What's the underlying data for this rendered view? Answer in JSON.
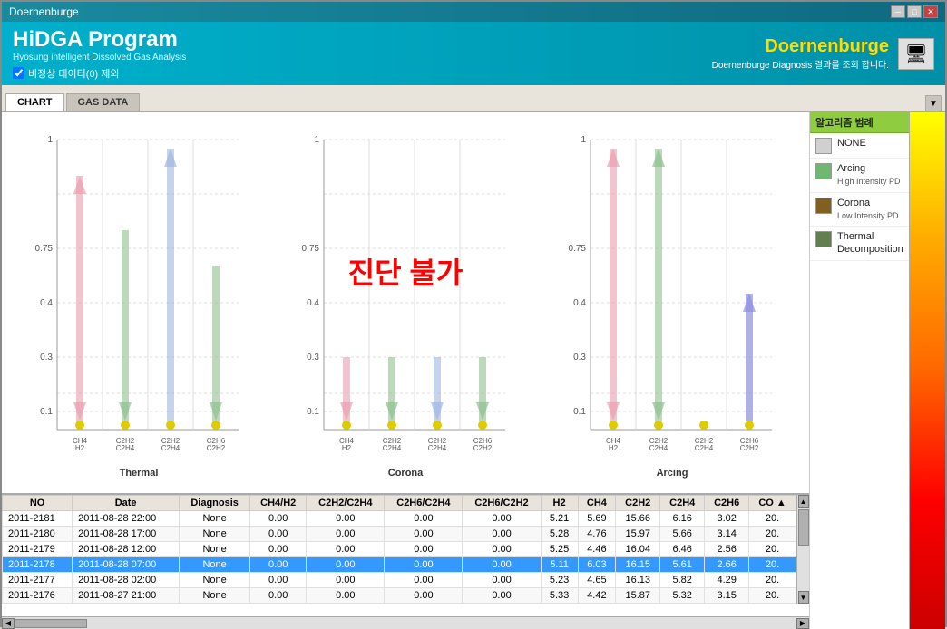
{
  "window": {
    "title": "Doernenburge"
  },
  "header": {
    "program_name": "HiDGA Program",
    "program_subtitle": "Hyosung intelligent Dissolved Gas Analysis",
    "checkbox_label": "비정상 데이터(0) 제외",
    "brand_name": "Doernenburge",
    "brand_subtitle": "Doernenburge Diagnosis 결과를 조회 합니다."
  },
  "tabs": [
    {
      "id": "chart",
      "label": "CHART",
      "active": true
    },
    {
      "id": "gas-data",
      "label": "GAS DATA",
      "active": false
    }
  ],
  "charts": [
    {
      "id": "thermal",
      "label": "Thermal",
      "x_labels": [
        "CH4\nH2",
        "C2H2\nC2H4",
        "C2H2\nC2H4",
        "C2H6\nC2H2"
      ],
      "overlay_text": ""
    },
    {
      "id": "corona",
      "label": "Corona",
      "x_labels": [
        "CH4\nH2",
        "C2H2\nC2H4",
        "C2H2\nC2H4",
        "C2H6\nC2H2"
      ],
      "overlay_text": "진단 불가"
    },
    {
      "id": "arcing",
      "label": "Arcing",
      "x_labels": [
        "CH4\nH2",
        "C2H2\nC2H4",
        "C2H2\nC2H4",
        "C2H6\nC2H2"
      ],
      "overlay_text": ""
    }
  ],
  "legend": {
    "header": "알고리즘 범례",
    "items": [
      {
        "id": "none",
        "color": "#d0d0d0",
        "label": "NONE",
        "sub": ""
      },
      {
        "id": "arcing",
        "color": "#70b870",
        "label": "Arcing",
        "sub": "High Intensity PD"
      },
      {
        "id": "corona",
        "color": "#806020",
        "label": "Corona",
        "sub": "Low Intensity PD"
      },
      {
        "id": "thermal",
        "color": "#608050",
        "label": "Thermal\nDecomposition",
        "sub": ""
      }
    ]
  },
  "table": {
    "columns": [
      "NO",
      "Date",
      "Diagnosis",
      "CH4/H2",
      "C2H2/C2H4",
      "C2H6/C2H4",
      "C2H6/C2H2",
      "H2",
      "CH4",
      "C2H2",
      "C2H4",
      "C2H6",
      "CO"
    ],
    "rows": [
      {
        "no": "2011-2181",
        "date": "2011-08-28 22:00",
        "diagnosis": "None",
        "ch4h2": "0.00",
        "c2h2c2h4": "0.00",
        "c2h6c2h4": "0.00",
        "c2h6c2h2": "0.00",
        "h2": "5.21",
        "ch4": "5.69",
        "c2h2": "15.66",
        "c2h4": "6.16",
        "c2h6": "3.02",
        "co": "20.",
        "selected": false
      },
      {
        "no": "2011-2180",
        "date": "2011-08-28 17:00",
        "diagnosis": "None",
        "ch4h2": "0.00",
        "c2h2c2h4": "0.00",
        "c2h6c2h4": "0.00",
        "c2h6c2h2": "0.00",
        "h2": "5.28",
        "ch4": "4.76",
        "c2h2": "15.97",
        "c2h4": "5.66",
        "c2h6": "3.14",
        "co": "20.",
        "selected": false
      },
      {
        "no": "2011-2179",
        "date": "2011-08-28 12:00",
        "diagnosis": "None",
        "ch4h2": "0.00",
        "c2h2c2h4": "0.00",
        "c2h6c2h4": "0.00",
        "c2h6c2h2": "0.00",
        "h2": "5.25",
        "ch4": "4.46",
        "c2h2": "16.04",
        "c2h4": "6.46",
        "c2h6": "2.56",
        "co": "20.",
        "selected": false
      },
      {
        "no": "2011-2178",
        "date": "2011-08-28 07:00",
        "diagnosis": "None",
        "ch4h2": "0.00",
        "c2h2c2h4": "0.00",
        "c2h6c2h4": "0.00",
        "c2h6c2h2": "0.00",
        "h2": "5.11",
        "ch4": "6.03",
        "c2h2": "16.15",
        "c2h4": "5.61",
        "c2h6": "2.66",
        "co": "20.",
        "selected": true
      },
      {
        "no": "2011-2177",
        "date": "2011-08-28 02:00",
        "diagnosis": "None",
        "ch4h2": "0.00",
        "c2h2c2h4": "0.00",
        "c2h6c2h4": "0.00",
        "c2h6c2h2": "0.00",
        "h2": "5.23",
        "ch4": "4.65",
        "c2h2": "16.13",
        "c2h4": "5.82",
        "c2h6": "4.29",
        "co": "20.",
        "selected": false
      },
      {
        "no": "2011-2176",
        "date": "2011-08-27 21:00",
        "diagnosis": "None",
        "ch4h2": "0.00",
        "c2h2c2h4": "0.00",
        "c2h6c2h4": "0.00",
        "c2h6c2h2": "0.00",
        "h2": "5.33",
        "ch4": "4.42",
        "c2h2": "15.87",
        "c2h4": "5.32",
        "c2h6": "3.15",
        "co": "20.",
        "selected": false
      }
    ]
  }
}
